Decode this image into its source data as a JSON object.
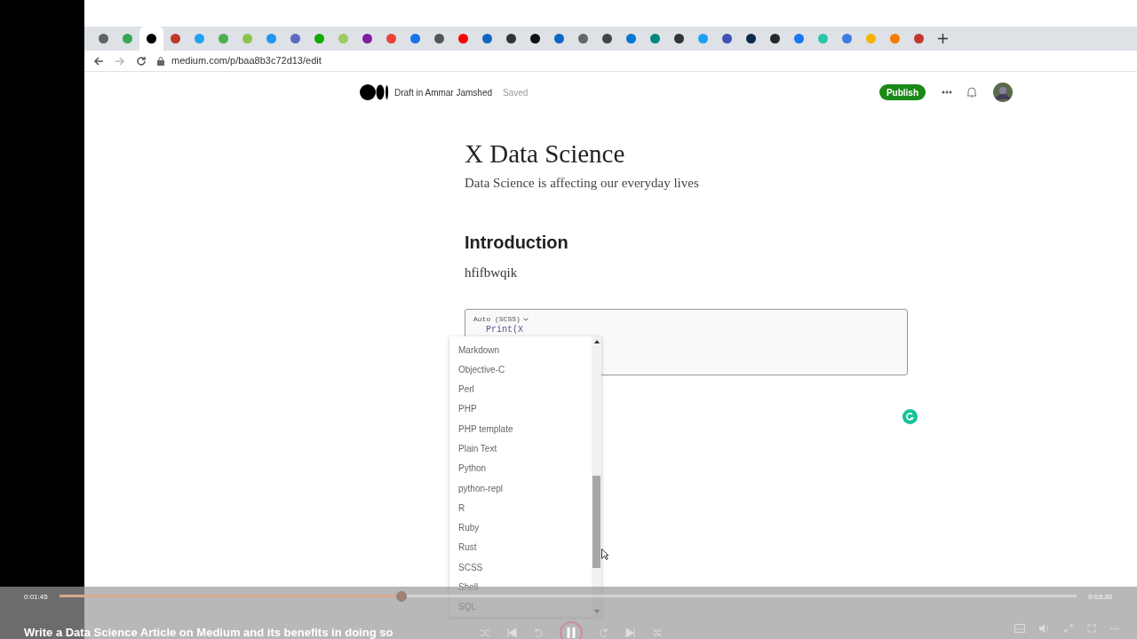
{
  "browser": {
    "tabs": [
      {
        "color": "#5f6368",
        "selected": false
      },
      {
        "color": "#34a853",
        "selected": false
      },
      {
        "color": "#000000",
        "selected": true
      },
      {
        "color": "#c0392b",
        "selected": false
      },
      {
        "color": "#1da1f2",
        "selected": false
      },
      {
        "color": "#4caf50",
        "selected": false
      },
      {
        "color": "#8bc34a",
        "selected": false
      },
      {
        "color": "#2196f3",
        "selected": false
      },
      {
        "color": "#5c6bc0",
        "selected": false
      },
      {
        "color": "#14a800",
        "selected": false
      },
      {
        "color": "#9ccc65",
        "selected": false
      },
      {
        "color": "#7b1fa2",
        "selected": false
      },
      {
        "color": "#ea4335",
        "selected": false
      },
      {
        "color": "#1a73e8",
        "selected": false
      },
      {
        "color": "#555555",
        "selected": false
      },
      {
        "color": "#ff0000",
        "selected": false
      },
      {
        "color": "#1565c0",
        "selected": false
      },
      {
        "color": "#333333",
        "selected": false
      },
      {
        "color": "#111111",
        "selected": false
      },
      {
        "color": "#0a66c2",
        "selected": false
      },
      {
        "color": "#666666",
        "selected": false
      },
      {
        "color": "#444444",
        "selected": false
      },
      {
        "color": "#0078d4",
        "selected": false
      },
      {
        "color": "#00897b",
        "selected": false
      },
      {
        "color": "#333333",
        "selected": false
      },
      {
        "color": "#1da1f2",
        "selected": false
      },
      {
        "color": "#3f51b5",
        "selected": false
      },
      {
        "color": "#0d2a4a",
        "selected": false
      },
      {
        "color": "#24292e",
        "selected": false
      },
      {
        "color": "#1877f2",
        "selected": false
      },
      {
        "color": "#26c6a6",
        "selected": false
      },
      {
        "color": "#3f7be0",
        "selected": false
      },
      {
        "color": "#f4b400",
        "selected": false
      },
      {
        "color": "#f57c00",
        "selected": false
      },
      {
        "color": "#c0392b",
        "selected": false
      }
    ],
    "url": "medium.com/p/baa8b3c72d13/edit"
  },
  "header": {
    "draft": "Draft in Ammar Jamshed",
    "status": "Saved",
    "publish": "Publish"
  },
  "article": {
    "title": "X Data Science",
    "subtitle": "Data Science is affecting our everyday lives",
    "heading": "Introduction",
    "paragraph": "hfifbwqik",
    "code_block": {
      "language": "Auto (SCSS)",
      "code": "Print(X"
    }
  },
  "language_menu": {
    "items": [
      "Markdown",
      "Objective-C",
      "Perl",
      "PHP",
      "PHP template",
      "Plain Text",
      "Python",
      "python-repl",
      "R",
      "Ruby",
      "Rust",
      "SCSS",
      "Shell",
      "SQL"
    ]
  },
  "player": {
    "elapsed": "0:01:45",
    "duration": "0:03:30",
    "level": 0.336,
    "title": "Write a Data Science Article on Medium and its benefits in doing so"
  }
}
